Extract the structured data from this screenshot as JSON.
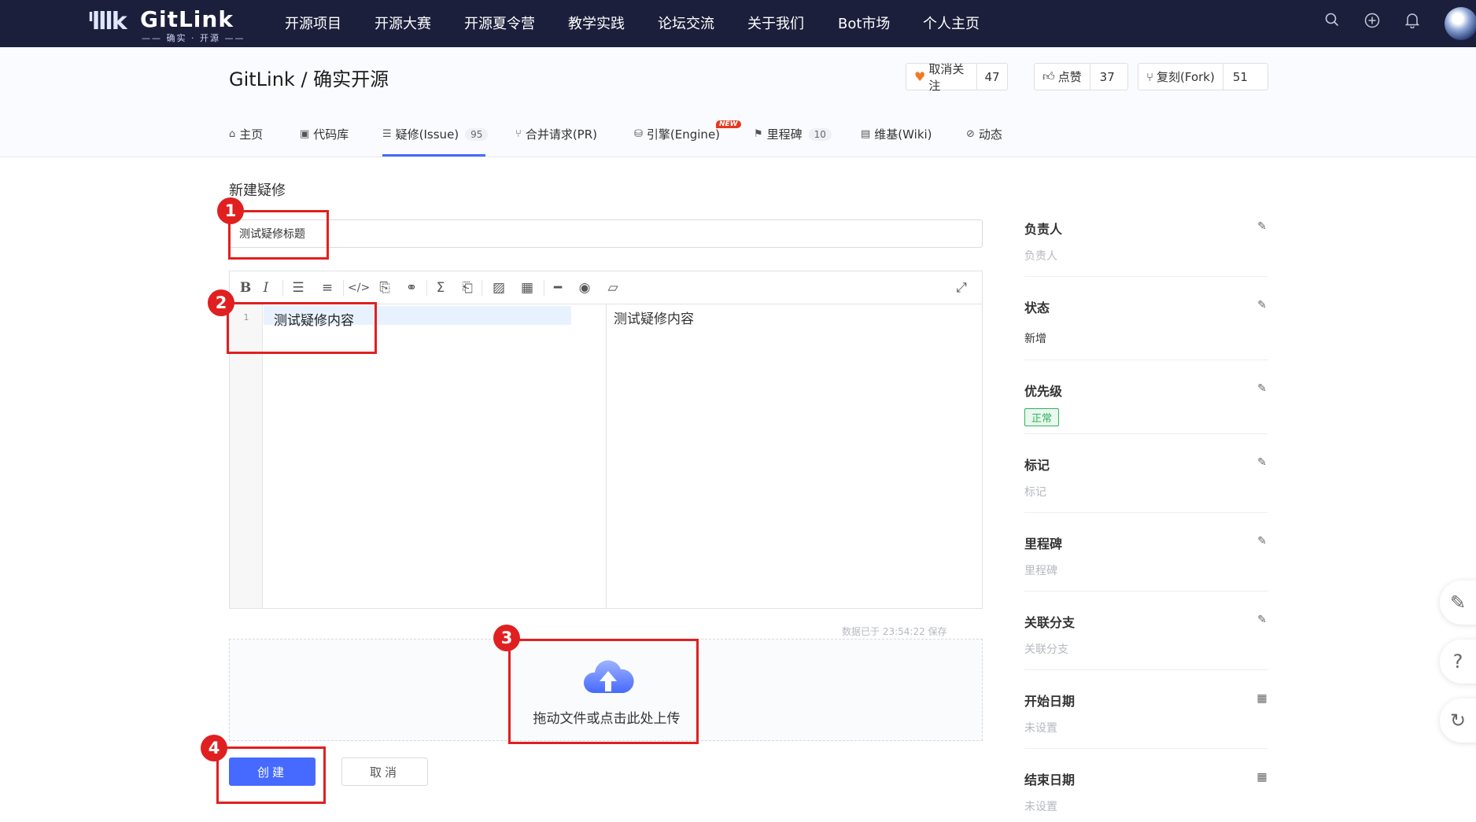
{
  "nav": {
    "logo_text": "GitLink",
    "logo_slogan": "—— 确实 · 开源 ——",
    "items": [
      "开源项目",
      "开源大赛",
      "开源夏令营",
      "教学实践",
      "论坛交流",
      "关于我们",
      "Bot市场",
      "个人主页"
    ],
    "icons": [
      "search-icon",
      "plus-circle-icon",
      "bell-icon"
    ]
  },
  "repo": {
    "title": "GitLink / 确实开源",
    "watch": {
      "label": "取消关注",
      "count": "47"
    },
    "star": {
      "label": "点赞",
      "count": "37"
    },
    "fork": {
      "label": "复刻(Fork)",
      "count": "51"
    },
    "tabs": [
      {
        "label": "主页"
      },
      {
        "label": "代码库"
      },
      {
        "label": "疑修(Issue)",
        "badge": "95"
      },
      {
        "label": "合并请求(PR)"
      },
      {
        "label": "引擎(Engine)",
        "tag": "NEW"
      },
      {
        "label": "里程碑",
        "badge": "10"
      },
      {
        "label": "维基(Wiki)"
      },
      {
        "label": "动态"
      }
    ],
    "active_tab": "疑修(Issue)"
  },
  "form": {
    "section_title": "新建疑修",
    "title_value": "测试疑修标题",
    "line_number": "1",
    "content_value": "测试疑修内容",
    "preview_value": "测试疑修内容",
    "saved_text": "数据已于 23:54:22 保存",
    "upload_text": "拖动文件或点击此处上传",
    "create_label": "创建",
    "cancel_label": "取消"
  },
  "annotations": [
    "1",
    "2",
    "3",
    "4"
  ],
  "sidebar": {
    "assignee": {
      "label": "负责人",
      "value": "负责人"
    },
    "status": {
      "label": "状态",
      "value": "新增"
    },
    "priority": {
      "label": "优先级",
      "value": "正常"
    },
    "tag": {
      "label": "标记",
      "value": "标记"
    },
    "milestone": {
      "label": "里程碑",
      "value": "里程碑"
    },
    "branch": {
      "label": "关联分支",
      "value": "关联分支"
    },
    "start_date": {
      "label": "开始日期",
      "value": "未设置"
    },
    "end_date": {
      "label": "结束日期",
      "value": "未设置"
    }
  },
  "colors": {
    "nav_bg": "#1b1f3b",
    "accent": "#466aff",
    "annotation_red": "#e02020",
    "priority_green": "#2fb35a"
  }
}
